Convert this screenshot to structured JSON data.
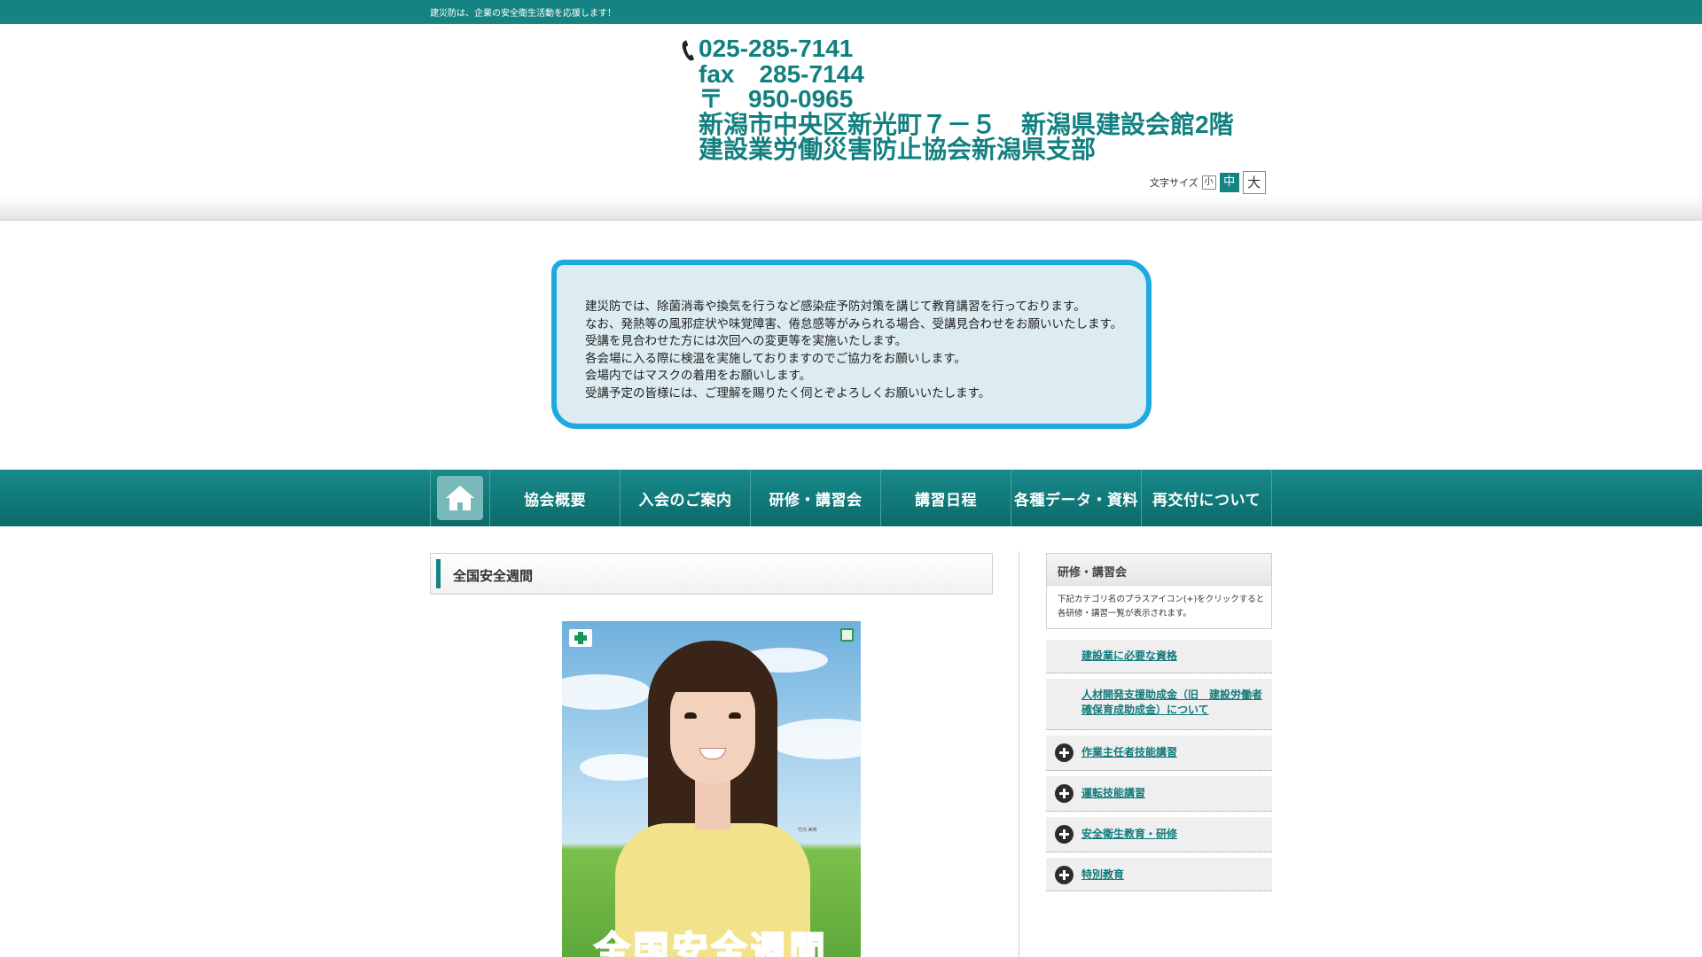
{
  "topbar": {
    "tagline": "建災防は、企業の安全衛生活動を応援します！"
  },
  "header": {
    "tel": "025-285-7141",
    "fax": "fax　285-7144",
    "postal": "〒　950-0965",
    "address": "新潟市中央区新光町７－５　新潟県建設会館2階",
    "org": "建設業労働災害防止協会新潟県支部",
    "font_size": {
      "label": "文字サイズ",
      "small": "小",
      "medium": "中",
      "large": "大",
      "selected": "中"
    }
  },
  "notice": {
    "lines": [
      "建災防では、除菌消毒や換気を行うなど感染症予防対策を講じて教育講習を行っております。",
      "なお、発熱等の風邪症状や味覚障害、倦怠感等がみられる場合、受講見合わせをお願いいたします。",
      "受講を見合わせた方には次回への変更等を実施いたします。",
      "各会場に入る際に検温を実施しておりますのでご協力をお願いします。",
      "会場内ではマスクの着用をお願いします。",
      "受講予定の皆様には、ご理解を賜りたく伺とぞよろしくお願いいたします。"
    ],
    "border_color": "#1ea9e1",
    "background": "#dcecf1"
  },
  "nav": {
    "home_icon": "home-icon",
    "items": [
      "協会概要",
      "入会のご案内",
      "研修・講習会",
      "講習日程",
      "各種データ・資料",
      "再交付について"
    ]
  },
  "main": {
    "page_title": "全国安全週間",
    "poster": {
      "title": "全国安全週間",
      "signature": "竹内 美宥"
    }
  },
  "sidebar": {
    "title": "研修・講習会",
    "desc_line1": "下記カテゴリ名のプラスアイコン(+)をクリックすると",
    "desc_line2": "各研修・講習一覧が表示されます。",
    "items": [
      {
        "label": "建設業に必要な資格",
        "expandable": false
      },
      {
        "label": "人材開発支援助成金（旧　建設労働者確保育成助成金）について",
        "expandable": false
      },
      {
        "label": "作業主任者技能講習",
        "expandable": true
      },
      {
        "label": "運転技能講習",
        "expandable": true
      },
      {
        "label": "安全衛生教育・研修",
        "expandable": true
      },
      {
        "label": "特別教育",
        "expandable": true
      }
    ]
  },
  "colors": {
    "brand_teal": "#168383",
    "link": "#127a7a"
  }
}
